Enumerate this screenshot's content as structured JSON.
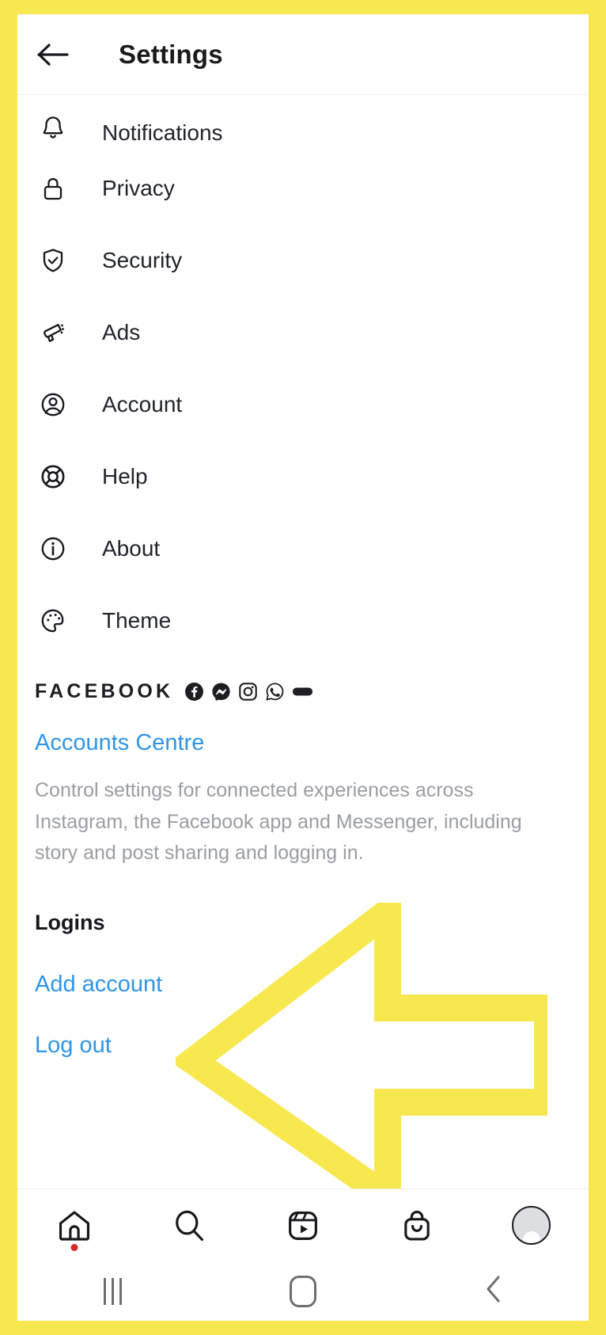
{
  "theme": {
    "highlight_yellow": "#f7e84f",
    "link_blue": "#2f95e8",
    "text_dark": "#20242b",
    "text_muted": "#9a9ea3",
    "notification_dot_red": "#d22d2d"
  },
  "header": {
    "back_icon": "back-arrow-icon",
    "title": "Settings"
  },
  "menu": {
    "items": [
      {
        "label": "Notifications",
        "icon": "bell-icon"
      },
      {
        "label": "Privacy",
        "icon": "lock-icon"
      },
      {
        "label": "Security",
        "icon": "shield-check-icon"
      },
      {
        "label": "Ads",
        "icon": "megaphone-icon"
      },
      {
        "label": "Account",
        "icon": "person-circle-icon"
      },
      {
        "label": "Help",
        "icon": "lifebuoy-icon"
      },
      {
        "label": "About",
        "icon": "info-circle-icon"
      },
      {
        "label": "Theme",
        "icon": "palette-icon"
      }
    ]
  },
  "facebook_section": {
    "wordmark": "FACEBOOK",
    "app_icons": [
      "facebook-icon",
      "messenger-icon",
      "instagram-icon",
      "whatsapp-icon",
      "oculus-icon"
    ],
    "accounts_centre_link": "Accounts Centre",
    "description": "Control settings for connected experiences across Instagram, the Facebook app and Messenger, including story and post sharing and logging in."
  },
  "logins_section": {
    "title": "Logins",
    "add_account_link": "Add account",
    "log_out_link": "Log out"
  },
  "annotation": {
    "shape": "left-pointing-arrow",
    "color": "#f7e84f",
    "points_at": "Add account"
  },
  "tabbar": {
    "tabs": [
      {
        "name": "home-tab",
        "icon": "home-icon",
        "has_dot": true
      },
      {
        "name": "search-tab",
        "icon": "search-icon",
        "has_dot": false
      },
      {
        "name": "reels-tab",
        "icon": "reels-icon",
        "has_dot": false
      },
      {
        "name": "shop-tab",
        "icon": "shopping-bag-icon",
        "has_dot": false
      },
      {
        "name": "profile-tab",
        "icon": "avatar-icon",
        "has_dot": false
      }
    ]
  },
  "system_nav": {
    "buttons": [
      {
        "name": "recents-button",
        "icon": "recents-icon"
      },
      {
        "name": "home-button",
        "icon": "home-square-icon"
      },
      {
        "name": "back-button",
        "icon": "chevron-left-icon"
      }
    ]
  }
}
